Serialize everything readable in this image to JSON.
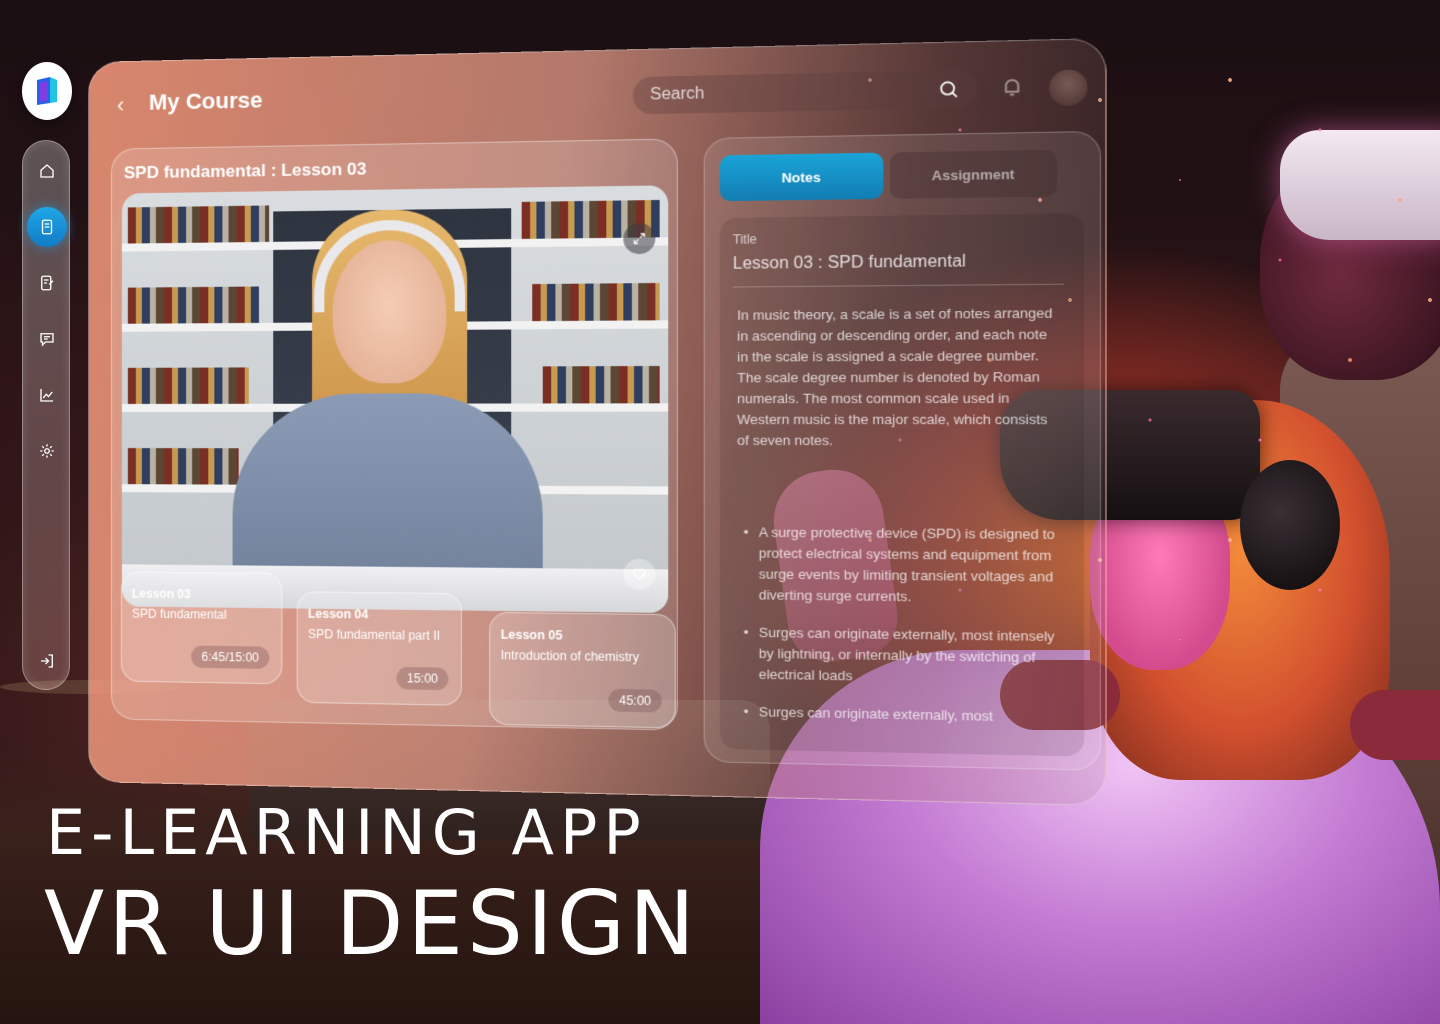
{
  "app": {
    "title": "My Course",
    "back_icon": "chevron-left-icon",
    "logo": "app-logo-icon"
  },
  "search": {
    "placeholder": "Search",
    "icon": "search-icon"
  },
  "sidebar": {
    "items": [
      {
        "icon": "home-icon",
        "active": false
      },
      {
        "icon": "book-icon",
        "active": true
      },
      {
        "icon": "notes-icon",
        "active": false
      },
      {
        "icon": "chat-icon",
        "active": false
      },
      {
        "icon": "chart-icon",
        "active": false
      },
      {
        "icon": "gear-icon",
        "active": false
      },
      {
        "icon": "logout-icon",
        "active": false
      }
    ]
  },
  "video": {
    "title": "SPD fundamental : Lesson 03",
    "expand_icon": "expand-icon",
    "favorite_icon": "heart-icon"
  },
  "lessons": [
    {
      "number": "Lesson 03",
      "name": "SPD fundamental",
      "time": "6:45/15:00"
    },
    {
      "number": "Lesson 04",
      "name": "SPD fundamental part II",
      "time": "15:00"
    },
    {
      "number": "Lesson 05",
      "name": "Introduction of chemistry",
      "time": "45:00"
    }
  ],
  "notes": {
    "tabs": [
      "Notes",
      "Assignment"
    ],
    "active_tab": "Notes",
    "label": "Title",
    "title": "Lesson 03 : SPD fundamental",
    "paragraph": "In music theory, a scale is a set of notes arranged in ascending or descending order, and each note in the scale is assigned a scale degree number. The scale degree number is denoted by Roman numerals. The most common scale used in Western music is the major scale, which consists of seven notes.",
    "bullets": [
      "A surge protective device (SPD) is designed to protect electrical systems and equipment from surge events by limiting transient voltages and diverting surge currents.",
      "Surges can originate externally, most intensely by lightning, or internally by the switching of electrical loads",
      "Surges can originate externally, most"
    ]
  },
  "headline": {
    "line1": "E-LEARNING APP",
    "line2": "VR UI DESIGN"
  },
  "colors": {
    "accent": "#1aa4d8",
    "panel": "#f2967a",
    "background": "#1a0e12"
  }
}
